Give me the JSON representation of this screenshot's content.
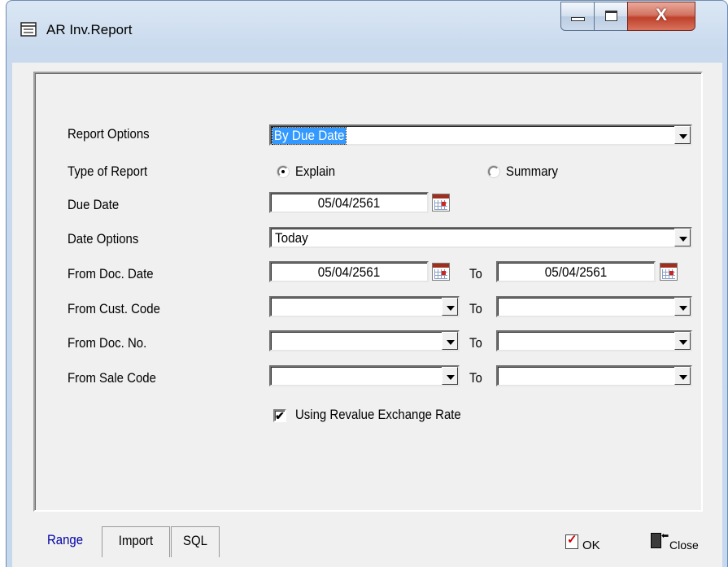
{
  "window": {
    "title": "AR Inv.Report"
  },
  "labels": {
    "report_options": "Report Options",
    "type_of_report": "Type of Report",
    "due_date": "Due Date",
    "date_options": "Date Options",
    "from_doc_date": "From Doc. Date",
    "from_cust_code": "From Cust. Code",
    "from_doc_no": "From Doc. No.",
    "from_sale_code": "From Sale Code",
    "to": "To"
  },
  "fields": {
    "report_options": "By Due Date",
    "type_explain": "Explain",
    "type_summary": "Summary",
    "type_selected": "Explain",
    "due_date": "05/04/2561",
    "date_options": "Today",
    "doc_date_from": "05/04/2561",
    "doc_date_to": "05/04/2561",
    "cust_code_from": "",
    "cust_code_to": "",
    "doc_no_from": "",
    "doc_no_to": "",
    "sale_code_from": "",
    "sale_code_to": "",
    "revalue_label": "Using Revalue Exchange Rate",
    "revalue_checked": true
  },
  "tabs": [
    {
      "label": "Range",
      "active": true
    },
    {
      "label": "Import",
      "active": false
    },
    {
      "label": "SQL",
      "active": false
    }
  ],
  "actions": {
    "ok": "OK",
    "close": "Close"
  },
  "colors": {
    "active_tab_text": "#0000a8",
    "selection": "#3399ff",
    "title_bar": "#c9daee"
  },
  "icons": [
    "form-icon",
    "minimize-icon",
    "maximize-icon",
    "close-icon",
    "calendar-icon",
    "ok-icon",
    "exit-door-icon"
  ]
}
